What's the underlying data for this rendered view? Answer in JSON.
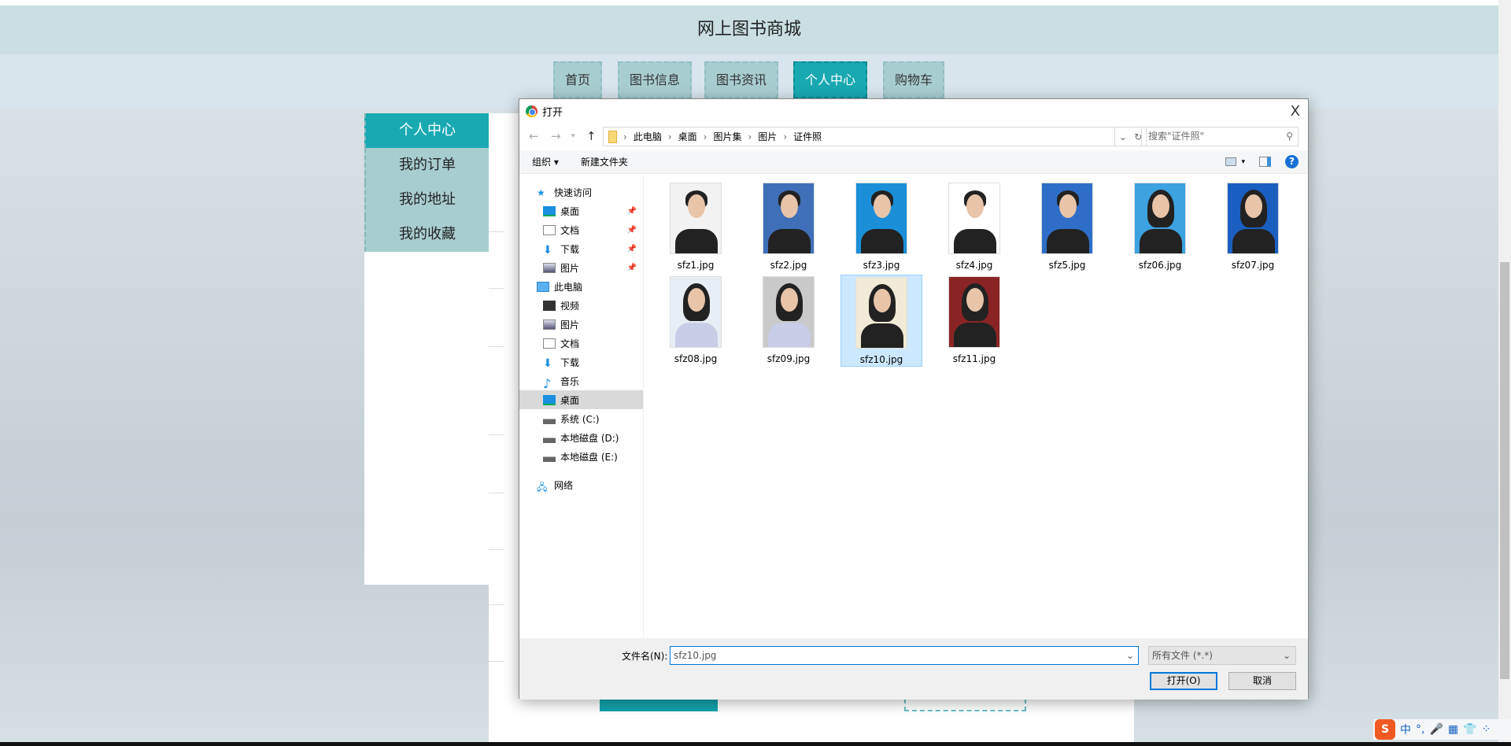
{
  "site": {
    "title": "网上图书商城",
    "nav": [
      {
        "label": "首页"
      },
      {
        "label": "图书信息"
      },
      {
        "label": "图书资讯"
      },
      {
        "label": "个人中心",
        "active": true
      },
      {
        "label": "购物车"
      }
    ],
    "sidebar": [
      {
        "label": "个人中心",
        "active": true
      },
      {
        "label": "我的订单"
      },
      {
        "label": "我的地址"
      },
      {
        "label": "我的收藏"
      }
    ]
  },
  "dialog": {
    "title": "打开",
    "close": "X",
    "path": [
      "此电脑",
      "桌面",
      "图片集",
      "图片",
      "证件照"
    ],
    "search_placeholder": "搜索\"证件照\"",
    "toolbar": {
      "organize": "组织 ▾",
      "new_folder": "新建文件夹"
    },
    "nav": {
      "quick_access": "快速访问",
      "quick": [
        {
          "label": "桌面"
        },
        {
          "label": "文档"
        },
        {
          "label": "下载"
        },
        {
          "label": "图片"
        }
      ],
      "this_pc": "此电脑",
      "pc": [
        {
          "label": "视频"
        },
        {
          "label": "图片"
        },
        {
          "label": "文档"
        },
        {
          "label": "下载"
        },
        {
          "label": "音乐"
        },
        {
          "label": "桌面"
        },
        {
          "label": "系统 (C:)"
        },
        {
          "label": "本地磁盘 (D:)"
        },
        {
          "label": "本地磁盘 (E:)"
        }
      ],
      "network": "网络"
    },
    "files": [
      {
        "name": "sfz1.jpg",
        "bg": "#f2f2f2"
      },
      {
        "name": "sfz2.jpg",
        "bg": "#3f6fb8"
      },
      {
        "name": "sfz3.jpg",
        "bg": "#1a8fd8"
      },
      {
        "name": "sfz4.jpg",
        "bg": "#ffffff"
      },
      {
        "name": "sfz5.jpg",
        "bg": "#2e6ec8"
      },
      {
        "name": "sfz06.jpg",
        "bg": "#3ca2e0"
      },
      {
        "name": "sfz07.jpg",
        "bg": "#1a5fc0"
      },
      {
        "name": "sfz08.jpg",
        "bg": "#e8eef5"
      },
      {
        "name": "sfz09.jpg",
        "bg": "#c9c9c9"
      },
      {
        "name": "sfz10.jpg",
        "bg": "#f0ead6",
        "selected": true
      },
      {
        "name": "sfz11.jpg",
        "bg": "#8a2424"
      }
    ],
    "filename_label": "文件名(N):",
    "filename": "sfz10.jpg",
    "filetype": "所有文件 (*.*)",
    "open": "打开(O)",
    "cancel": "取消"
  },
  "ime": {
    "logo": "S",
    "items": [
      "中",
      "°,",
      "🎤",
      "▦",
      "👕",
      "⁘"
    ]
  }
}
